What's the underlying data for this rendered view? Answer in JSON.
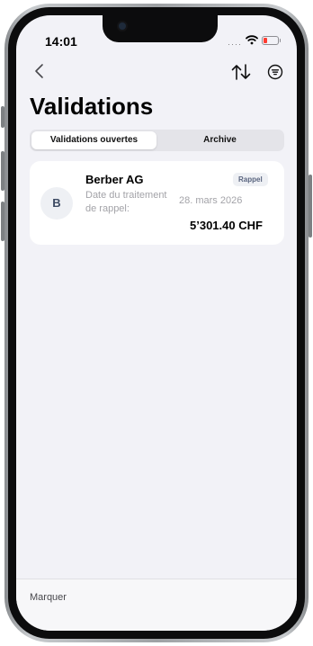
{
  "status_bar": {
    "time": "14:01"
  },
  "nav": {
    "back_icon": "chevron-left-icon",
    "sort_icon": "sort-arrows-icon",
    "filter_icon": "filter-icon"
  },
  "page": {
    "title": "Validations"
  },
  "tabs": [
    {
      "label": "Validations ouvertes",
      "active": true
    },
    {
      "label": "Archive",
      "active": false
    }
  ],
  "items": [
    {
      "avatar": "B",
      "name": "Berber AG",
      "badge": "Rappel",
      "date_label": "Date du traitement de rappel:",
      "date": "28. mars 2026",
      "amount": "5’301.40 CHF"
    }
  ],
  "bottom_bar": {
    "action_label": "Marquer"
  },
  "colors": {
    "background": "#f2f2f7",
    "card": "#ffffff",
    "text_primary": "#000000",
    "text_secondary": "#a3a3a8",
    "badge_bg": "#eef0f4",
    "battery_low": "#ff3b30"
  }
}
